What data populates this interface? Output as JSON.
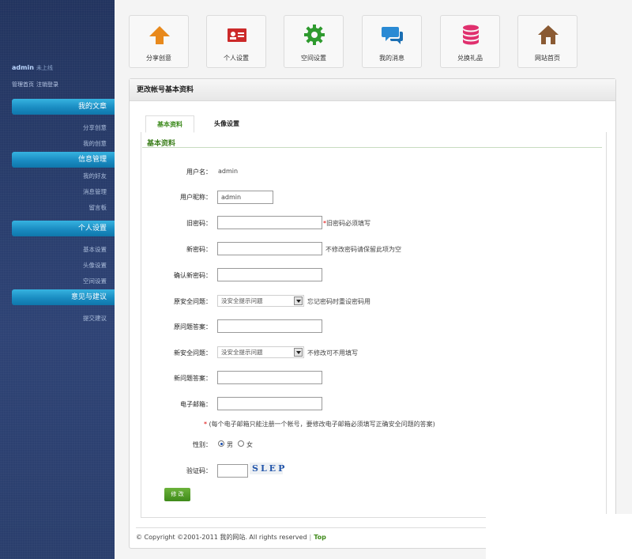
{
  "sidebar": {
    "username": "admin",
    "status": "未上线",
    "links": [
      "管理首页",
      "注销登录"
    ],
    "sections": [
      {
        "title": "我的文章",
        "items": [
          "分享创意",
          "我的创意"
        ]
      },
      {
        "title": "信息管理",
        "items": [
          "我的好友",
          "消息管理",
          "留言板"
        ]
      },
      {
        "title": "个人设置",
        "items": [
          "基本设置",
          "头像设置",
          "空间设置"
        ]
      },
      {
        "title": "意见与建议",
        "items": [
          "提交建议"
        ]
      }
    ]
  },
  "toolbar": [
    {
      "label": "分享创意",
      "icon": "arrow-up-icon",
      "color": "#e8891c"
    },
    {
      "label": "个人设置",
      "icon": "id-card-icon",
      "color": "#cc2a2a"
    },
    {
      "label": "空间设置",
      "icon": "gear-icon",
      "color": "#2e9a2e"
    },
    {
      "label": "我的消息",
      "icon": "chat-bubbles-icon",
      "color": "#2a8ad4"
    },
    {
      "label": "兑换礼品",
      "icon": "database-icon",
      "color": "#e0306e"
    },
    {
      "label": "网站首页",
      "icon": "home-icon",
      "color": "#8a5a33"
    }
  ],
  "panel": {
    "title": "更改帐号基本资料",
    "tabs": [
      "基本资料",
      "头像设置"
    ],
    "form_title": "基本资料"
  },
  "form": {
    "username_label": "用户名：",
    "username_value": "admin",
    "nickname_label": "用户昵称：",
    "nickname_value": "admin",
    "old_password_label": "旧密码：",
    "old_password_hint": "旧密码必须填写",
    "new_password_label": "新密码：",
    "new_password_hint": "不修改密码请保留此项为空",
    "confirm_password_label": "确认新密码：",
    "old_question_label": "原安全问题：",
    "old_question_value": "没安全提示问题",
    "old_question_hint": "忘记密码时重设密码用",
    "old_answer_label": "原问题答案：",
    "new_question_label": "新安全问题：",
    "new_question_value": "没安全提示问题",
    "new_question_hint": "不修改可不用填写",
    "new_answer_label": "新问题答案：",
    "email_label": "电子邮箱：",
    "email_note": "(每个电子邮箱只能注册一个帐号，要修改电子邮箱必须填写正确安全问题的答案)",
    "gender_label": "性别：",
    "gender_male": "男",
    "gender_female": "女",
    "captcha_label": "验证码：",
    "captcha_text": "SLEP",
    "submit_label": "修 改"
  },
  "footer": {
    "copyright": "© Copyright ©2001-2011 我的网站. All rights reserved",
    "separator": "|",
    "top_link": "Top"
  }
}
